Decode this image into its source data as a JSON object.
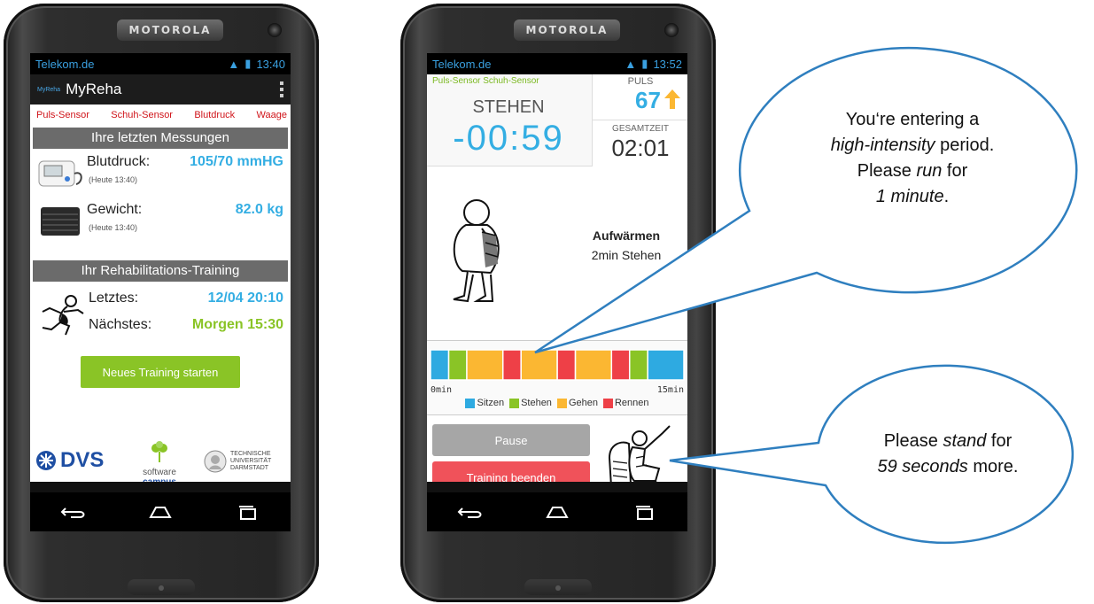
{
  "phone1": {
    "brand": "MOTOROLA",
    "status": {
      "carrier": "Telekom.de",
      "time": "13:40"
    },
    "app": {
      "logo_text": "MyReha",
      "title": "MyReha"
    },
    "tabs": [
      "Puls-Sensor",
      "Schuh-Sensor",
      "Blutdruck",
      "Waage"
    ],
    "measurements": {
      "header": "Ihre letzten Messungen",
      "blood_pressure": {
        "label": "Blutdruck:",
        "value": "105/70 mmHG",
        "time": "(Heute 13:40)"
      },
      "weight": {
        "label": "Gewicht:",
        "value": "82.0 kg",
        "time": "(Heute 13:40)"
      }
    },
    "training": {
      "header": "Ihr Rehabilitations-Training",
      "last": {
        "label": "Letztes:",
        "value": "12/04 20:10",
        "color": "#34aee3"
      },
      "next": {
        "label": "Nächstes:",
        "value": "Morgen 15:30",
        "color": "#8ac426"
      },
      "start_button": "Neues Training starten"
    },
    "logos": {
      "dvs": "DVS",
      "software_campus": [
        "software",
        "campus"
      ],
      "tu": [
        "TECHNISCHE",
        "UNIVERSITÄT",
        "DARMSTADT"
      ]
    }
  },
  "phone2": {
    "brand": "MOTOROLA",
    "status": {
      "carrier": "Telekom.de",
      "time": "13:52"
    },
    "sensors": "Puls-Sensor  Schuh-Sensor",
    "state": "STEHEN",
    "countdown": "-00:59",
    "pulse": {
      "label": "PULS",
      "value": "67",
      "trend": "up"
    },
    "total": {
      "label": "GESAMTZEIT",
      "value": "02:01"
    },
    "exercise": {
      "name": "Aufwärmen",
      "detail": "2min Stehen"
    },
    "timeline": {
      "start_label": "0min",
      "end_label": "15min",
      "segments": [
        {
          "type": "Sitzen",
          "minutes": 1
        },
        {
          "type": "Stehen",
          "minutes": 1
        },
        {
          "type": "Gehen",
          "minutes": 2
        },
        {
          "type": "Rennen",
          "minutes": 1
        },
        {
          "type": "Gehen",
          "minutes": 2
        },
        {
          "type": "Rennen",
          "minutes": 1
        },
        {
          "type": "Gehen",
          "minutes": 2
        },
        {
          "type": "Rennen",
          "minutes": 1
        },
        {
          "type": "Stehen",
          "minutes": 1
        },
        {
          "type": "Sitzen",
          "minutes": 2
        }
      ],
      "legend": [
        {
          "label": "Sitzen",
          "color": "#2eaae1"
        },
        {
          "label": "Stehen",
          "color": "#8ac426"
        },
        {
          "label": "Gehen",
          "color": "#fbb732"
        },
        {
          "label": "Rennen",
          "color": "#ee4047"
        }
      ]
    },
    "buttons": {
      "pause": "Pause",
      "end": "Training beenden"
    }
  },
  "callouts": {
    "upper": {
      "l1": "You‘re entering a",
      "l2a": "high-intensity",
      "l2b": " period.",
      "l3a": "Please ",
      "l3b": "run",
      "l3c": " for",
      "l4a": "1 minute",
      "l4b": "."
    },
    "lower": {
      "l1a": "Please ",
      "l1b": "stand",
      "l1c": " for",
      "l2a": "59 seconds",
      "l2b": " more."
    }
  }
}
